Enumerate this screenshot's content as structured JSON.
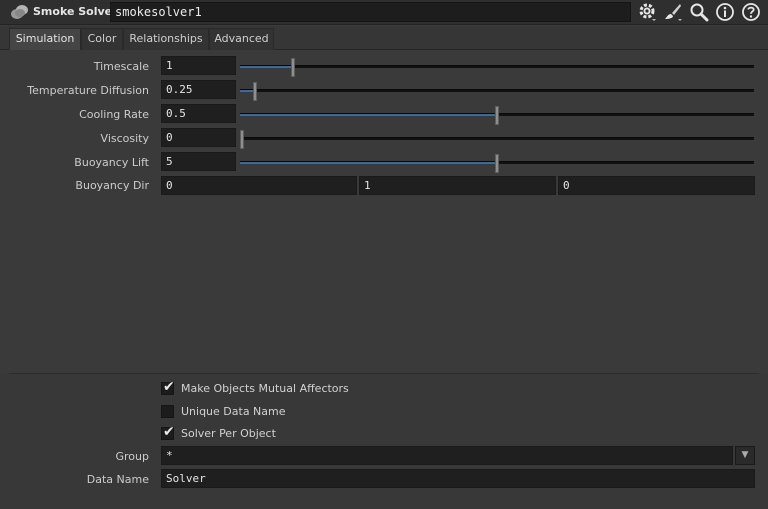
{
  "header": {
    "node_type": "Smoke Solver",
    "node_name": "smokesolver1"
  },
  "icons": {
    "node": "smoke-node-icon",
    "gear": "gear-icon",
    "brush": "brush-icon",
    "search": "search-icon",
    "info": "info-icon",
    "help": "help-icon"
  },
  "tabs": [
    {
      "label": "Simulation",
      "active": true
    },
    {
      "label": "Color",
      "active": false
    },
    {
      "label": "Relationships",
      "active": false
    },
    {
      "label": "Advanced",
      "active": false
    }
  ],
  "params": {
    "timescale": {
      "label": "Timescale",
      "value": "1",
      "fraction": 0.1
    },
    "temperature_diffusion": {
      "label": "Temperature Diffusion",
      "value": "0.25",
      "fraction": 0.025
    },
    "cooling_rate": {
      "label": "Cooling Rate",
      "value": "0.5",
      "fraction": 0.5
    },
    "viscosity": {
      "label": "Viscosity",
      "value": "0",
      "fraction": 0.0
    },
    "buoyancy_lift": {
      "label": "Buoyancy Lift",
      "value": "5",
      "fraction": 0.5
    },
    "buoyancy_dir": {
      "label": "Buoyancy Dir",
      "x": "0",
      "y": "1",
      "z": "0"
    }
  },
  "toggles": {
    "mutual_affectors": {
      "label": "Make Objects Mutual Affectors",
      "checked": true
    },
    "unique_data_name": {
      "label": "Unique Data Name",
      "checked": false
    },
    "solver_per_object": {
      "label": "Solver Per Object",
      "checked": true
    }
  },
  "group": {
    "label": "Group",
    "value": "*"
  },
  "data_name": {
    "label": "Data Name",
    "value": "Solver"
  },
  "colors": {
    "background": "#3a3a3a",
    "field": "#1f1f1f",
    "slider_fill": "#3c6a9e"
  }
}
